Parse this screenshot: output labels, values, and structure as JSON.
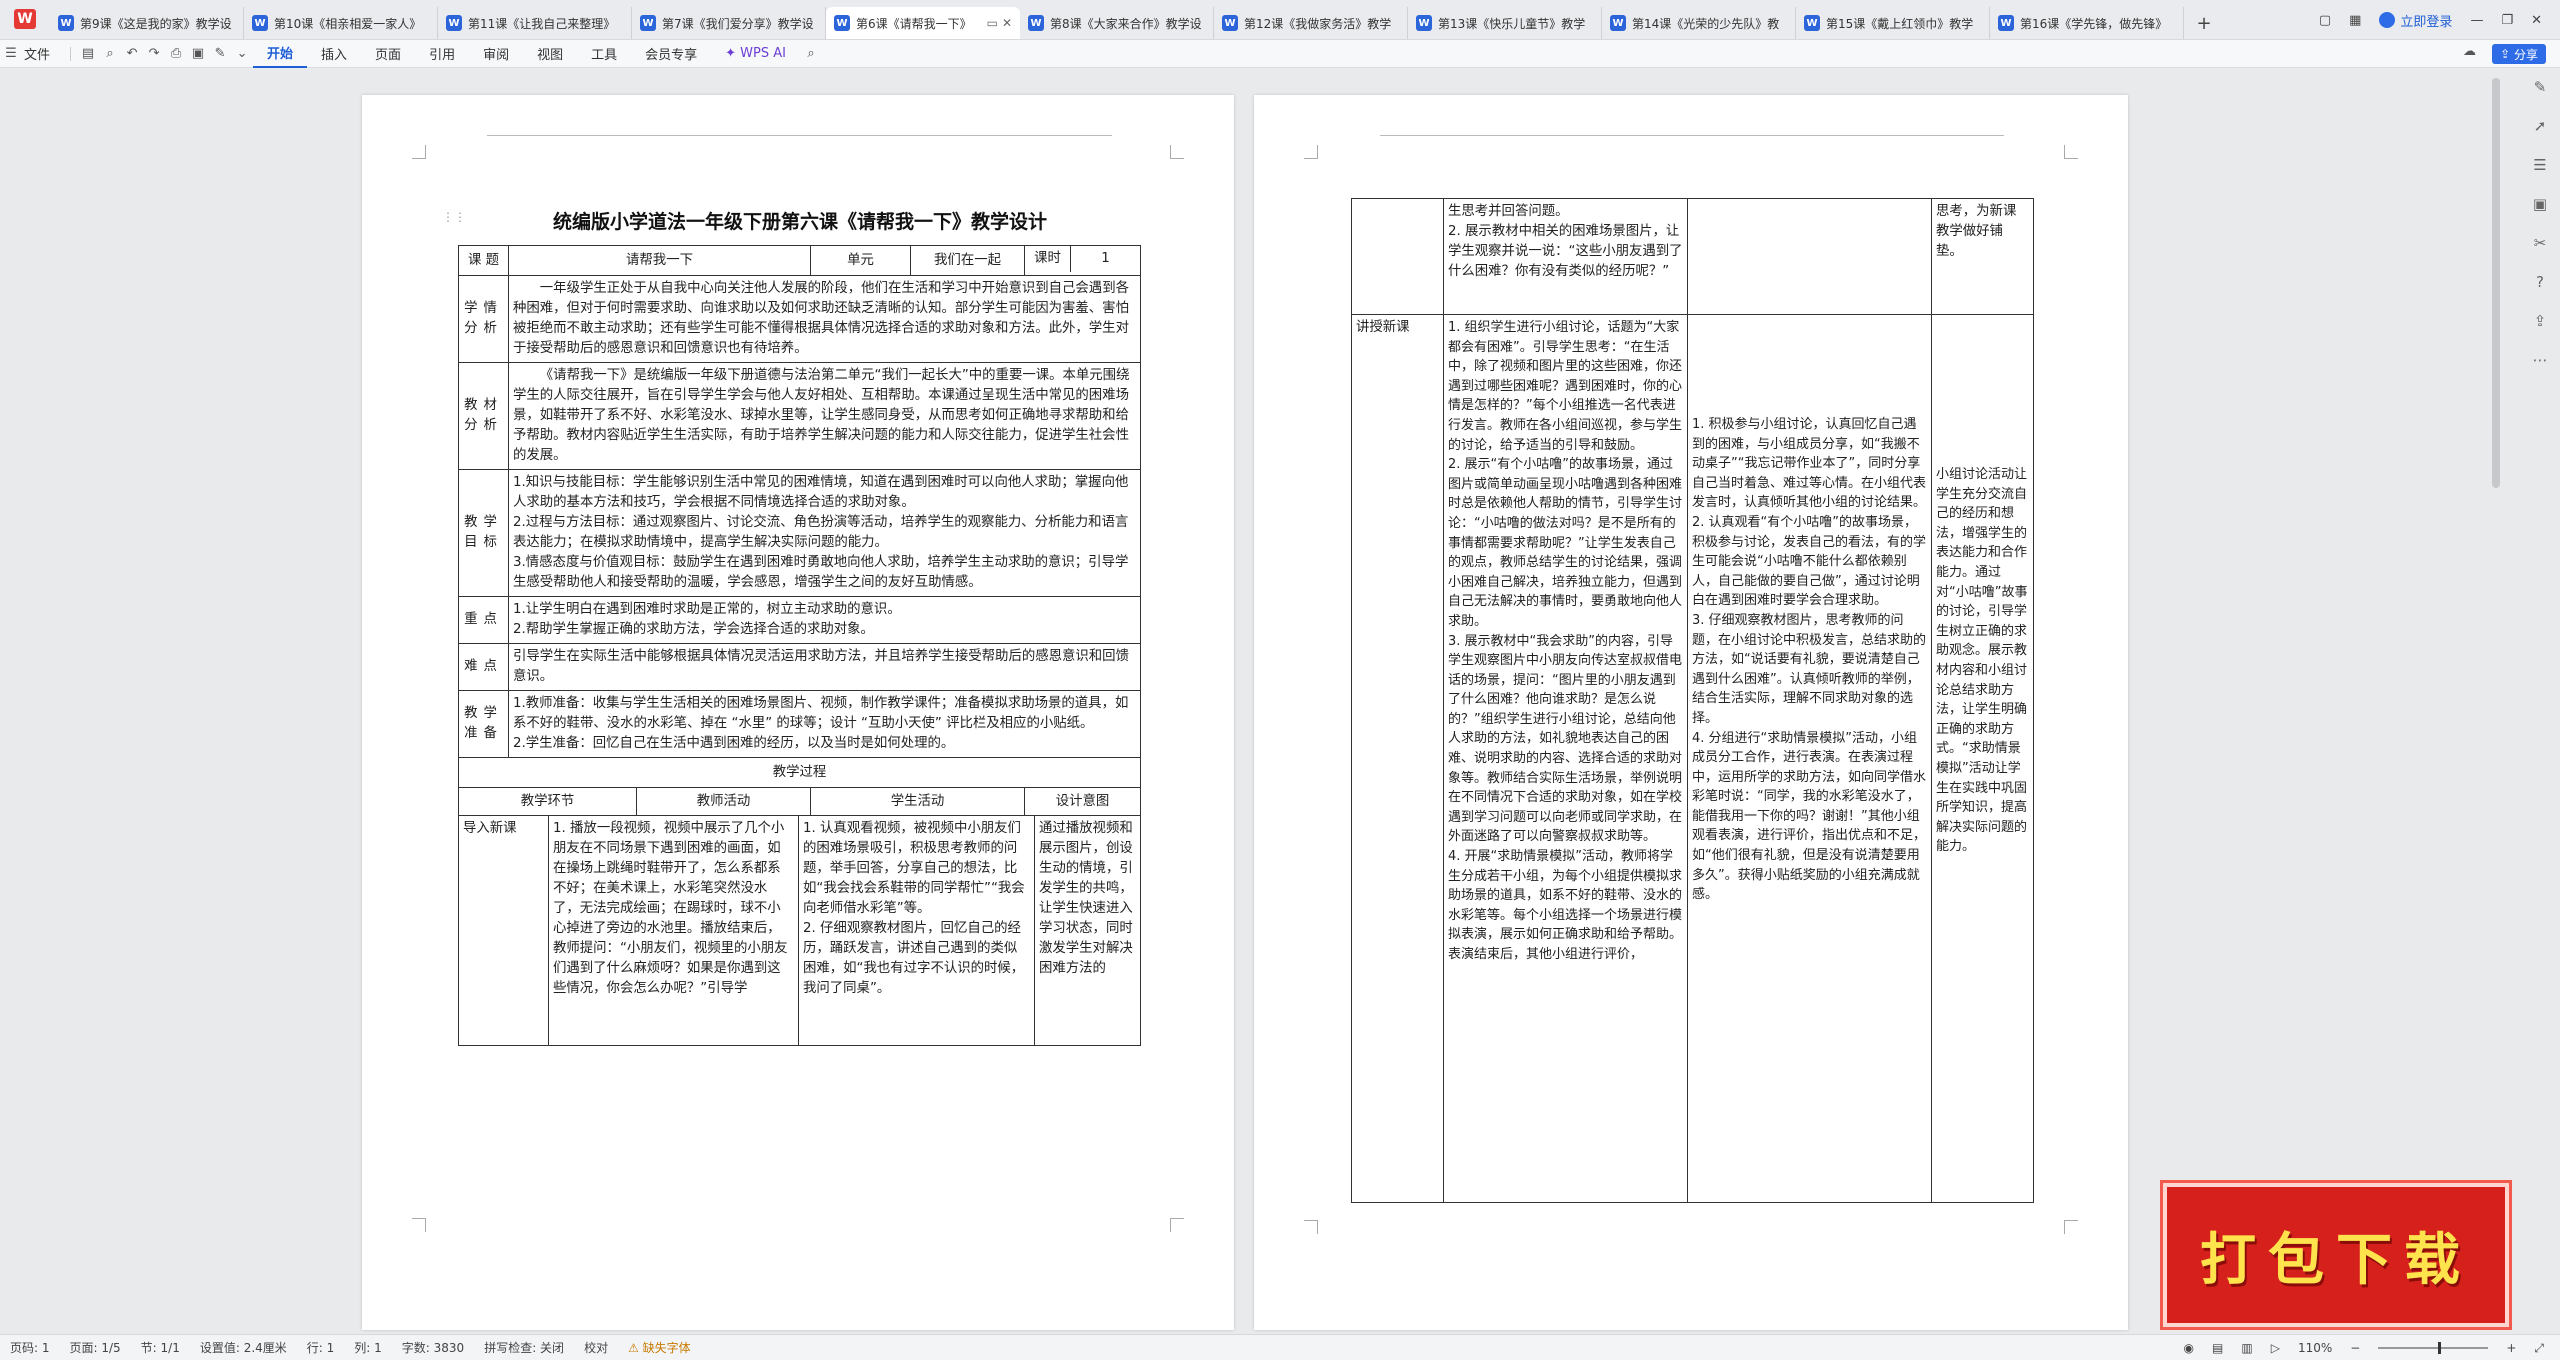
{
  "tabs": [
    "第9课《这是我的家》教学设",
    "第10课《相亲相爱一家人》",
    "第11课《让我自己来整理》",
    "第7课《我们爱分享》教学设",
    "第6课《请帮我一下》",
    "第8课《大家来合作》教学设",
    "第12课《我做家务活》教学",
    "第13课《快乐儿童节》教学",
    "第14课《光荣的少先队》教",
    "第15课《戴上红领巾》教学",
    "第16课《学先锋，做先锋》"
  ],
  "topbar": {
    "login": "立即登录"
  },
  "ribbon": {
    "file": "文件",
    "menus": [
      "开始",
      "插入",
      "页面",
      "引用",
      "审阅",
      "视图",
      "工具",
      "会员专享"
    ],
    "ai": "WPS AI",
    "share": "分享"
  },
  "doc": {
    "title": "统编版小学道法一年级下册第六课《请帮我一下》教学设计",
    "head": {
      "course_label": "课 题",
      "course": "请帮我一下",
      "unit_label": "单元",
      "unit": "我们在一起",
      "period_label": "课时",
      "period": "1"
    },
    "rows": [
      {
        "label": "学情分析",
        "text": "一年级学生正处于从自我中心向关注他人发展的阶段，他们在生活和学习中开始意识到自己会遇到各种困难，但对于何时需要求助、向谁求助以及如何求助还缺乏清晰的认知。部分学生可能因为害羞、害怕被拒绝而不敢主动求助；还有些学生可能不懂得根据具体情况选择合适的求助对象和方法。此外，学生对于接受帮助后的感恩意识和回馈意识也有待培养。"
      },
      {
        "label": "教材分析",
        "text": "《请帮我一下》是统编版一年级下册道德与法治第二单元“我们一起长大”中的重要一课。本单元围绕学生的人际交往展开，旨在引导学生学会与他人友好相处、互相帮助。本课通过呈现生活中常见的困难场景，如鞋带开了系不好、水彩笔没水、球掉水里等，让学生感同身受，从而思考如何正确地寻求帮助和给予帮助。教材内容贴近学生生活实际，有助于培养学生解决问题的能力和人际交往能力，促进学生社会性的发展。"
      },
      {
        "label": "教学目标",
        "lines": [
          "1.知识与技能目标：学生能够识别生活中常见的困难情境，知道在遇到困难时可以向他人求助；掌握向他人求助的基本方法和技巧，学会根据不同情境选择合适的求助对象。",
          "2.过程与方法目标：通过观察图片、讨论交流、角色扮演等活动，培养学生的观察能力、分析能力和语言表达能力；在模拟求助情境中，提高学生解决实际问题的能力。",
          "3.情感态度与价值观目标：鼓励学生在遇到困难时勇敢地向他人求助，培养学生主动求助的意识；引导学生感受帮助他人和接受帮助的温暖，学会感恩，增强学生之间的友好互助情感。"
        ]
      },
      {
        "label": "重点",
        "lines": [
          "1.让学生明白在遇到困难时求助是正常的，树立主动求助的意识。",
          "2.帮助学生掌握正确的求助方法，学会选择合适的求助对象。"
        ]
      },
      {
        "label": "难点",
        "text": "引导学生在实际生活中能够根据具体情况灵活运用求助方法，并且培养学生接受帮助后的感恩意识和回馈意识。"
      },
      {
        "label": "教学准备",
        "lines": [
          "1.教师准备：收集与学生生活相关的困难场景图片、视频，制作教学课件；准备模拟求助场景的道具，如系不好的鞋带、没水的水彩笔、掉在 “水里” 的球等；设计 “互助小天使” 评比栏及相应的小贴纸。",
          "2.学生准备：回忆自己在生活中遇到困难的经历，以及当时是如何处理的。"
        ]
      }
    ],
    "process_title": "教学过程",
    "cols": [
      "教学环节",
      "教师活动",
      "学生活动",
      "设计意图"
    ],
    "intro": {
      "stage": "导入新课",
      "teacher": "1. 播放一段视频，视频中展示了几个小朋友在不同场景下遇到困难的画面，如在操场上跳绳时鞋带开了，怎么系都系不好；在美术课上，水彩笔突然没水了，无法完成绘画；在踢球时，球不小心掉进了旁边的水池里。播放结束后，教师提问：“小朋友们，视频里的小朋友们遇到了什么麻烦呀？如果是你遇到这些情况，你会怎么办呢？”引导学",
      "student": "1. 认真观看视频，被视频中小朋友们的困难场景吸引，积极思考教师的问题，举手回答，分享自己的想法，比如“我会找会系鞋带的同学帮忙”“我会向老师借水彩笔”等。\n2. 仔细观察教材图片，回忆自己的经历，踊跃发言，讲述自己遇到的类似困难，如“我也有过字不认识的时候，我问了同桌”。",
      "intent": "通过播放视频和展示图片，创设生动的情境，引发学生的共鸣，让学生快速进入学习状态，同时激发学生对解决困难方法的"
    },
    "p2_cont": {
      "teacher": "生思考并回答问题。\n2. 展示教材中相关的困难场景图片，让学生观察并说一说：“这些小朋友遇到了什么困难？你有没有类似的经历呢？”",
      "student": "",
      "intent": "思考，为新课教学做好铺垫。"
    },
    "main": {
      "stage": "讲授新课",
      "teacher": "1. 组织学生进行小组讨论，话题为“大家都会有困难”。引导学生思考：“在生活中，除了视频和图片里的这些困难，你还遇到过哪些困难呢？遇到困难时，你的心情是怎样的？”每个小组推选一名代表进行发言。教师在各小组间巡视，参与学生的讨论，给予适当的引导和鼓励。\n2. 展示“有个小咕噜”的故事场景，通过图片或简单动画呈现小咕噜遇到各种困难时总是依赖他人帮助的情节，引导学生讨论：“小咕噜的做法对吗？是不是所有的事情都需要求帮助呢？”让学生发表自己的观点，教师总结学生的讨论结果，强调小困难自己解决，培养独立能力，但遇到自己无法解决的事情时，要勇敢地向他人求助。\n3. 展示教材中“我会求助”的内容，引导学生观察图片中小朋友向传达室叔叔借电话的场景，提问：“图片里的小朋友遇到了什么困难？他向谁求助？是怎么说的？”组织学生进行小组讨论，总结向他人求助的方法，如礼貌地表达自己的困难、说明求助的内容、选择合适的求助对象等。教师结合实际生活场景，举例说明在不同情况下合适的求助对象，如在学校遇到学习问题可以向老师或同学求助，在外面迷路了可以向警察叔叔求助等。\n4. 开展“求助情景模拟”活动，教师将学生分成若干小组，为每个小组提供模拟求助场景的道具，如系不好的鞋带、没水的水彩笔等。每个小组选择一个场景进行模拟表演，展示如何正确求助和给予帮助。表演结束后，其他小组进行评价，",
      "student": "1. 积极参与小组讨论，认真回忆自己遇到的困难，与小组成员分享，如“我搬不动桌子”“我忘记带作业本了”，同时分享自己当时着急、难过等心情。在小组代表发言时，认真倾听其他小组的讨论结果。\n2. 认真观看“有个小咕噜”的故事场景，积极参与讨论，发表自己的看法，有的学生可能会说“小咕噜不能什么都依赖别人，自己能做的要自己做”，通过讨论明白在遇到困难时要学会合理求助。\n3. 仔细观察教材图片，思考教师的问题，在小组讨论中积极发言，总结求助的方法，如“说话要有礼貌，要说清楚自己遇到什么困难”。认真倾听教师的举例，结合生活实际，理解不同求助对象的选择。\n4. 分组进行“求助情景模拟”活动，小组成员分工合作，进行表演。在表演过程中，运用所学的求助方法，如向同学借水彩笔时说：“同学，我的水彩笔没水了，能借我用一下你的吗？谢谢！”其他小组观看表演，进行评价，指出优点和不足，如“他们很有礼貌，但是没有说清楚要用多久”。获得小贴纸奖励的小组充满成就感。",
      "intent": "小组讨论活动让学生充分交流自己的经历和想法，增强学生的表达能力和合作能力。通过对“小咕噜”故事的讨论，引导学生树立正确的求助观念。展示教材内容和小组讨论总结求助方法，让学生明确正确的求助方式。“求助情景模拟”活动让学生在实践中巩固所学知识，提高解决实际问题的能力。"
    }
  },
  "promo": "打包下载",
  "status": {
    "page_num": "页码: 1",
    "pages": "页面: 1/5",
    "section": "节: 1/1",
    "setting": "设置值: 2.4厘米",
    "row": "行: 1",
    "col": "列: 1",
    "words": "字数: 3830",
    "spell": "拼写检查: 关闭",
    "proof": "校对",
    "missing_font": "缺失字体",
    "zoom": "110%"
  }
}
